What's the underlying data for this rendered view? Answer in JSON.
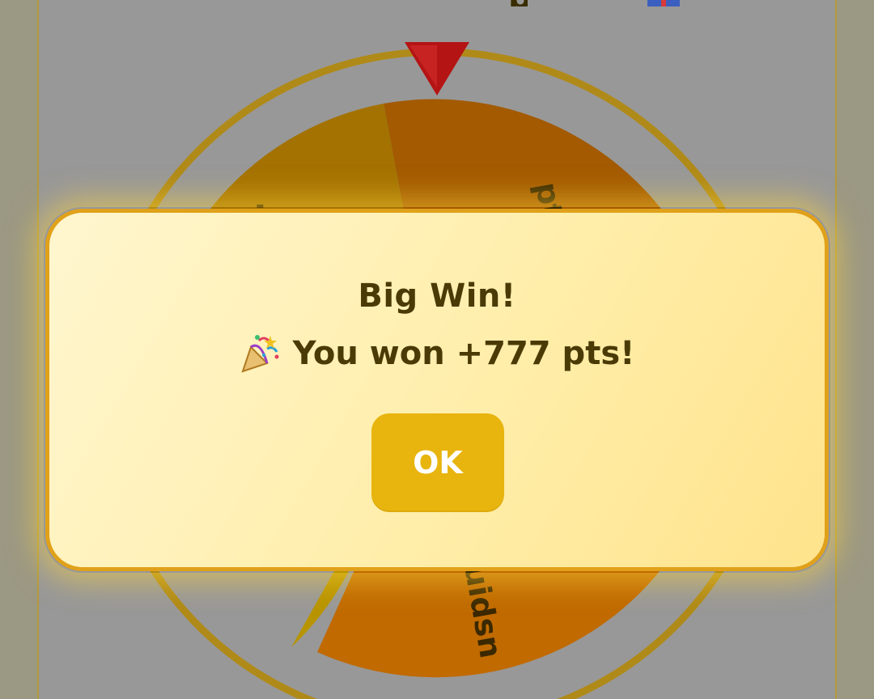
{
  "modal": {
    "title": "Big Win!",
    "message": "You won +777 pts!",
    "ok_label": "OK"
  },
  "wheel": {
    "segment_labels": [
      "pts",
      "uidsn"
    ],
    "pointer_icon": "triangle-pointer-icon",
    "rim_color": "#b08a18"
  },
  "icons": {
    "party": "party-popper-icon",
    "gift": "gift-icon"
  },
  "colors": {
    "accent": "#e8b40e",
    "modal_border": "#e0a11a",
    "text": "#4a3a06",
    "pointer": "#c01818"
  }
}
